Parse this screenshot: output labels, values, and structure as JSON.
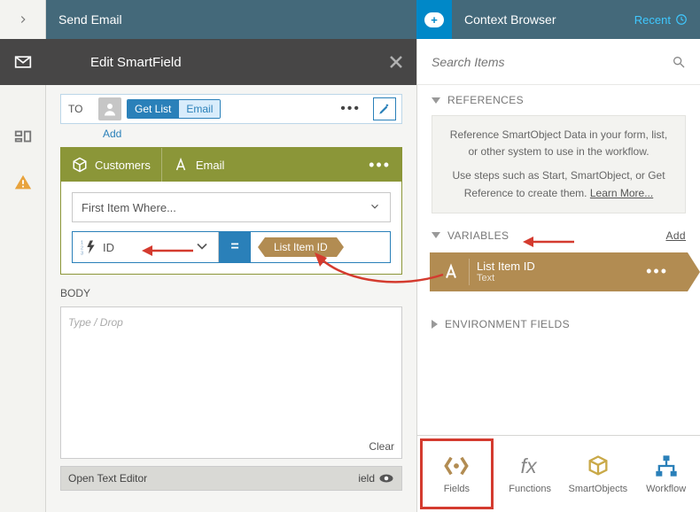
{
  "header": {
    "left_title": "Send Email",
    "right_title": "Context Browser",
    "recent_label": "Recent"
  },
  "editor": {
    "title": "Edit SmartField",
    "to_label": "TO",
    "pill_action": "Get List",
    "pill_field": "Email",
    "add_label": "Add",
    "smartobject": "Customers",
    "smartobject_field": "Email",
    "filter_select": "First Item Where...",
    "cond_field": "ID",
    "cond_value": "List Item ID",
    "body_label": "BODY",
    "body_placeholder": "Type / Drop",
    "clear_label": "Clear",
    "open_text_editor": "Open Text Editor",
    "field_suffix": "ield"
  },
  "context": {
    "search_placeholder": "Search Items",
    "sections": {
      "references": "REFERENCES",
      "variables": "VARIABLES",
      "environment": "ENVIRONMENT FIELDS"
    },
    "references_info_1": "Reference SmartObject Data in your form, list, or other system to use in the workflow.",
    "references_info_2": "Use steps such as Start, SmartObject, or Get Reference to create them.",
    "learn_more": "Learn More...",
    "variables_add": "Add",
    "variable": {
      "name": "List Item ID",
      "type": "Text"
    },
    "tabs": {
      "fields": "Fields",
      "functions": "Functions",
      "smartobjects": "SmartObjects",
      "workflow": "Workflow"
    }
  }
}
